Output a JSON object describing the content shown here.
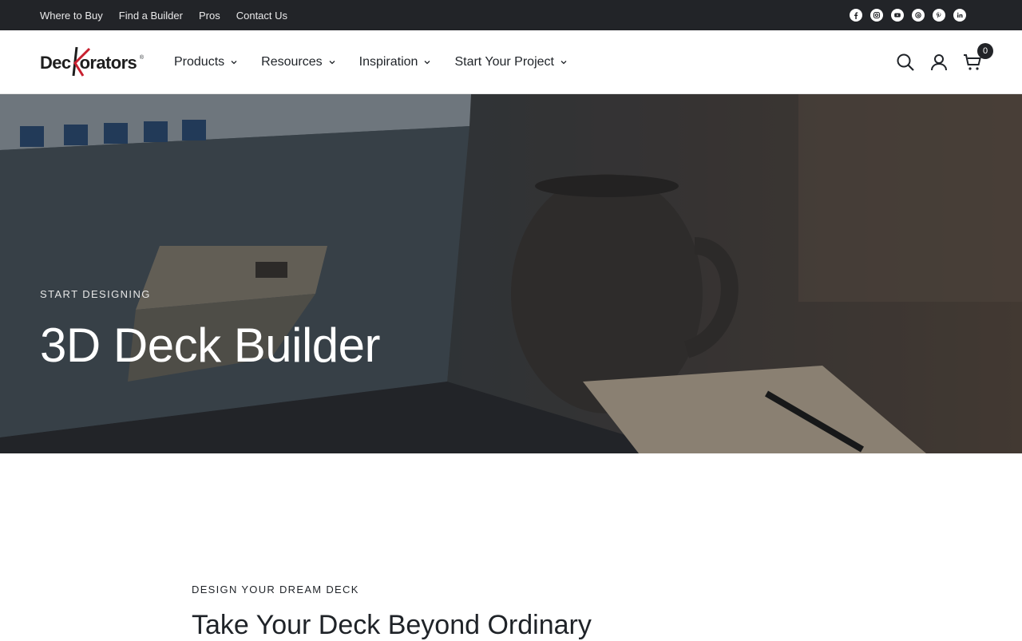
{
  "topbar": {
    "links": [
      "Where to Buy",
      "Find a Builder",
      "Pros",
      "Contact Us"
    ],
    "social_icons": [
      "facebook-icon",
      "instagram-icon",
      "youtube-icon",
      "threads-icon",
      "pinterest-icon",
      "linkedin-icon"
    ]
  },
  "header": {
    "logo_text": "Deckorators",
    "nav": [
      {
        "label": "Products"
      },
      {
        "label": "Resources"
      },
      {
        "label": "Inspiration"
      },
      {
        "label": "Start Your Project"
      }
    ],
    "cart_count": "0"
  },
  "hero": {
    "eyebrow": "START DESIGNING",
    "title": "3D Deck Builder"
  },
  "section": {
    "eyebrow": "DESIGN YOUR DREAM DECK",
    "title": "Take Your Deck Beyond Ordinary"
  },
  "colors": {
    "topbar_bg": "#222428",
    "logo_accent": "#c8202f"
  }
}
